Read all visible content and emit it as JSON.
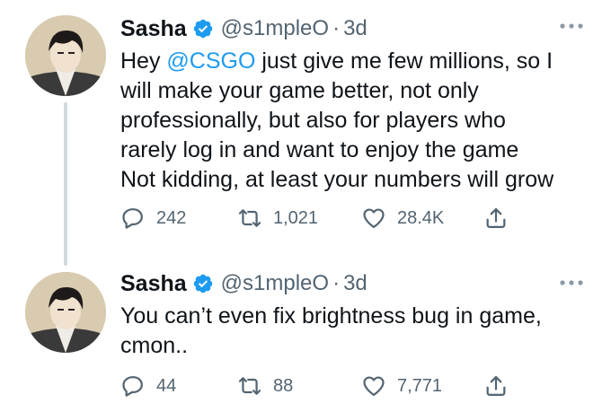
{
  "tweets": [
    {
      "author": {
        "name": "Sasha",
        "handle": "@s1mpleO",
        "separator": "·",
        "time": "3d",
        "verified": true
      },
      "text_lines": [
        {
          "prefix": "Hey ",
          "mention": "@CSGO",
          "suffix": " just give me few millions, so I"
        },
        {
          "prefix": "will make your game better, not only",
          "mention": "",
          "suffix": ""
        },
        {
          "prefix": "professionally, but also for players who",
          "mention": "",
          "suffix": ""
        },
        {
          "prefix": "rarely log in and want to enjoy the game",
          "mention": "",
          "suffix": ""
        },
        {
          "prefix": "Not kidding, at least your numbers will grow",
          "mention": "",
          "suffix": ""
        }
      ],
      "stats": {
        "replies": "242",
        "retweets": "1,021",
        "likes": "28.4K"
      }
    },
    {
      "author": {
        "name": "Sasha",
        "handle": "@s1mpleO",
        "separator": "·",
        "time": "3d",
        "verified": true
      },
      "text_lines": [
        {
          "prefix": "You can’t even fix brightness bug in game,",
          "mention": "",
          "suffix": ""
        },
        {
          "prefix": "cmon..",
          "mention": "",
          "suffix": ""
        }
      ],
      "stats": {
        "replies": "44",
        "retweets": "88",
        "likes": "7,771"
      }
    }
  ],
  "colors": {
    "accent": "#1d9bf0",
    "text": "#0f1419",
    "secondary": "#536471",
    "thread_line": "#cfd9de"
  },
  "icons": {
    "verified": "verified-badge-icon",
    "more": "more-options-icon",
    "reply": "reply-icon",
    "retweet": "retweet-icon",
    "like": "heart-icon",
    "share": "share-icon"
  }
}
